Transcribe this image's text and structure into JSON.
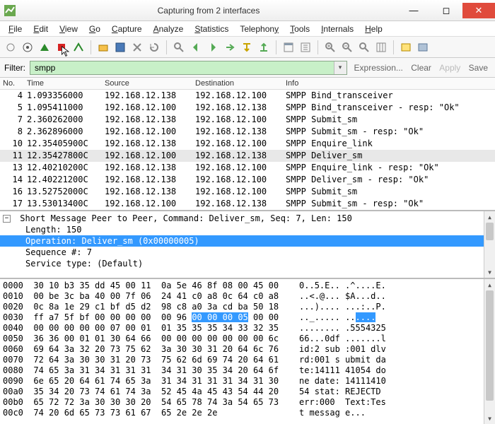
{
  "window": {
    "title": "Capturing from 2 interfaces"
  },
  "menu": [
    "File",
    "Edit",
    "View",
    "Go",
    "Capture",
    "Analyze",
    "Statistics",
    "Telephony",
    "Tools",
    "Internals",
    "Help"
  ],
  "filter": {
    "label": "Filter:",
    "value": "smpp",
    "links": {
      "expression": "Expression...",
      "clear": "Clear",
      "apply": "Apply",
      "save": "Save"
    }
  },
  "packet_headers": [
    "No.",
    "Time",
    "Source",
    "Destination",
    "Info"
  ],
  "packets": [
    {
      "no": "4",
      "time": "1.093356000",
      "src": "192.168.12.138",
      "dst": "192.168.12.100",
      "info": "SMPP Bind_transceiver"
    },
    {
      "no": "5",
      "time": "1.095411000",
      "src": "192.168.12.100",
      "dst": "192.168.12.138",
      "info": "SMPP Bind_transceiver - resp: \"Ok\""
    },
    {
      "no": "7",
      "time": "2.360262000",
      "src": "192.168.12.138",
      "dst": "192.168.12.100",
      "info": "SMPP Submit_sm"
    },
    {
      "no": "8",
      "time": "2.362896000",
      "src": "192.168.12.100",
      "dst": "192.168.12.138",
      "info": "SMPP Submit_sm - resp: \"Ok\""
    },
    {
      "no": "10",
      "time": "12.35405900C",
      "src": "192.168.12.138",
      "dst": "192.168.12.100",
      "info": "SMPP Enquire_link"
    },
    {
      "no": "11",
      "time": "12.35427800C",
      "src": "192.168.12.100",
      "dst": "192.168.12.138",
      "info": "SMPP Deliver_sm",
      "sel": true
    },
    {
      "no": "13",
      "time": "12.40210200C",
      "src": "192.168.12.138",
      "dst": "192.168.12.100",
      "info": "SMPP Enquire_link - resp: \"Ok\""
    },
    {
      "no": "14",
      "time": "12.40221200C",
      "src": "192.168.12.138",
      "dst": "192.168.12.100",
      "info": "SMPP Deliver_sm - resp: \"Ok\""
    },
    {
      "no": "16",
      "time": "13.52752000C",
      "src": "192.168.12.138",
      "dst": "192.168.12.100",
      "info": "SMPP Submit_sm"
    },
    {
      "no": "17",
      "time": "13.53013400C",
      "src": "192.168.12.100",
      "dst": "192.168.12.138",
      "info": "SMPP Submit_sm - resp: \"Ok\""
    }
  ],
  "tree": {
    "root": "Short Message Peer to Peer, Command: Deliver_sm, Seq: 7, Len: 150",
    "children": [
      "Length: 150",
      "Operation: Deliver_sm (0x00000005)",
      "Sequence #: 7",
      "Service type: (Default)"
    ],
    "selected_index": 1
  },
  "hex": {
    "rows": [
      {
        "off": "0000",
        "b": "30 10 b3 35 dd 45 00 11  0a 5e 46 8f 08 00 45 00",
        "a": "0..5.E.. .^....E."
      },
      {
        "off": "0010",
        "b": "00 be 3c ba 40 00 7f 06  24 41 c0 a8 0c 64 c0 a8",
        "a": "..<.@... $A...d.."
      },
      {
        "off": "0020",
        "b": "0c 8a 1e 29 c1 bf d5 d2  98 c8 a0 3a cd ba 50 18",
        "a": "...).... ...:..P."
      },
      {
        "off": "0030",
        "b": "ff a7 5f bf 00 00 00 00  00 96 ",
        "a": ".._..... ..",
        "b_hl": "00 00 00 05",
        "a_hl": "....",
        "b_tail": " 00 00"
      },
      {
        "off": "0040",
        "b": "00 00 00 00 00 07 00 01  01 35 35 35 34 33 32 35",
        "a": "........ .5554325"
      },
      {
        "off": "0050",
        "b": "36 36 00 01 01 30 64 66  00 00 00 00 00 00 00 6c",
        "a": "66...0df .......l"
      },
      {
        "off": "0060",
        "b": "69 64 3a 32 20 73 75 62  3a 30 30 31 20 64 6c 76",
        "a": "id:2 sub :001 dlv"
      },
      {
        "off": "0070",
        "b": "72 64 3a 30 30 31 20 73  75 62 6d 69 74 20 64 61",
        "a": "rd:001 s ubmit da"
      },
      {
        "off": "0080",
        "b": "74 65 3a 31 34 31 31 31  34 31 30 35 34 20 64 6f",
        "a": "te:14111 41054 do"
      },
      {
        "off": "0090",
        "b": "6e 65 20 64 61 74 65 3a  31 34 31 31 31 34 31 30",
        "a": "ne date: 14111410"
      },
      {
        "off": "00a0",
        "b": "35 34 20 73 74 61 74 3a  52 45 4a 45 43 54 44 20",
        "a": "54 stat: REJECTD "
      },
      {
        "off": "00b0",
        "b": "65 72 72 3a 30 30 30 20  54 65 78 74 3a 54 65 73",
        "a": "err:000  Text:Tes"
      },
      {
        "off": "00c0",
        "b": "74 20 6d 65 73 73 61 67  65 2e 2e 2e            ",
        "a": "t messag e..."
      }
    ]
  }
}
